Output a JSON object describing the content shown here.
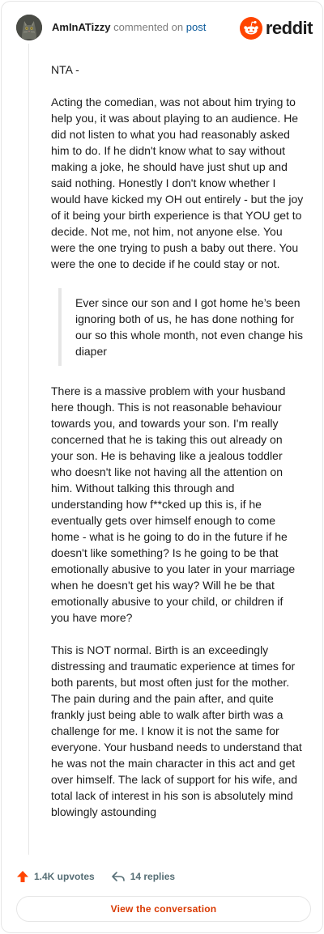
{
  "header": {
    "username": "AmInATizzy",
    "commented_on": "commented on",
    "post_link": "post",
    "brand": "reddit"
  },
  "comment": {
    "paragraphs": [
      "NTA -",
      "Acting the comedian, was not about him trying to help you, it was about playing to an audience. He did not listen to what you had reasonably asked him to do. If he didn't know what to say without making a joke, he should have just shut up and said nothing. Honestly I don't know whether I would have kicked my OH out entirely - but the joy of it being your birth experience is that YOU get to decide. Not me, not him, not anyone else. You were the one trying to push a baby out there. You were the one to decide if he could stay or not."
    ],
    "quote": "Ever since our son and I got home he’s been ignoring both of us, he has done nothing for our so this whole month, not even change his diaper",
    "paragraphs_after": [
      "There is a massive problem with your husband here though. This is not reasonable behaviour towards you, and towards your son. I'm really concerned that he is taking this out already on your son. He is behaving like a jealous toddler who doesn't like not having all the attention on him. Without talking this through and understanding how f**cked up this is, if he eventually gets over himself enough to come home - what is he going to do in the future if he doesn't like something? Is he going to be that emotionally abusive to you later in your marriage when he doesn't get his way? Will he be that emotionally abusive to your child, or children if you have more?",
      "This is NOT normal. Birth is an exceedingly distressing and traumatic experience at times for both parents, but most often just for the mother. The pain during and the pain after, and quite frankly just being able to walk after birth was a challenge for me. I know it is not the same for everyone. Your husband needs to understand that he was not the main character in this act and get over himself. The lack of support for his wife, and total lack of interest in his son is absolutely mind blowingly astounding"
    ]
  },
  "actions": {
    "upvotes": "1.4K upvotes",
    "replies": "14 replies"
  },
  "button": {
    "view_conversation": "View the conversation"
  },
  "colors": {
    "brand_orange": "#ff4500",
    "button_text": "#d93900",
    "link": "#0b5a9b"
  },
  "icons": {
    "avatar": "cat-avatar",
    "brand": "reddit-logo-icon",
    "upvote": "upvote-arrow-icon",
    "reply": "reply-arrow-icon"
  }
}
